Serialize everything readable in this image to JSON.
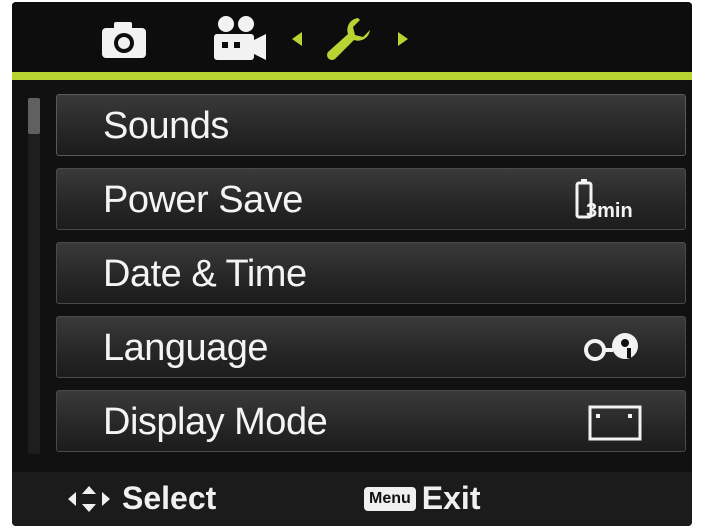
{
  "tabs": {
    "camera": {
      "icon": "camera-icon"
    },
    "movie": {
      "icon": "movie-camera-icon"
    },
    "setup": {
      "icon": "wrench-icon",
      "selected": true
    }
  },
  "colors": {
    "accent": "#b8d433",
    "background": "#0b0b0b",
    "item_bg": "#2a2a2a",
    "text": "#f4f4f4"
  },
  "menu": {
    "items": [
      {
        "label": "Sounds"
      },
      {
        "label": "Power Save",
        "value": "3min",
        "value_icon": "battery-icon"
      },
      {
        "label": "Date & Time"
      },
      {
        "label": "Language",
        "value_icon": "language-icon"
      },
      {
        "label": "Display Mode",
        "value_icon": "display-mode-icon"
      }
    ]
  },
  "footer": {
    "select_label": "Select",
    "select_icon": "four-way-arrows-icon",
    "menu_key": "Menu",
    "exit_label": "Exit"
  }
}
